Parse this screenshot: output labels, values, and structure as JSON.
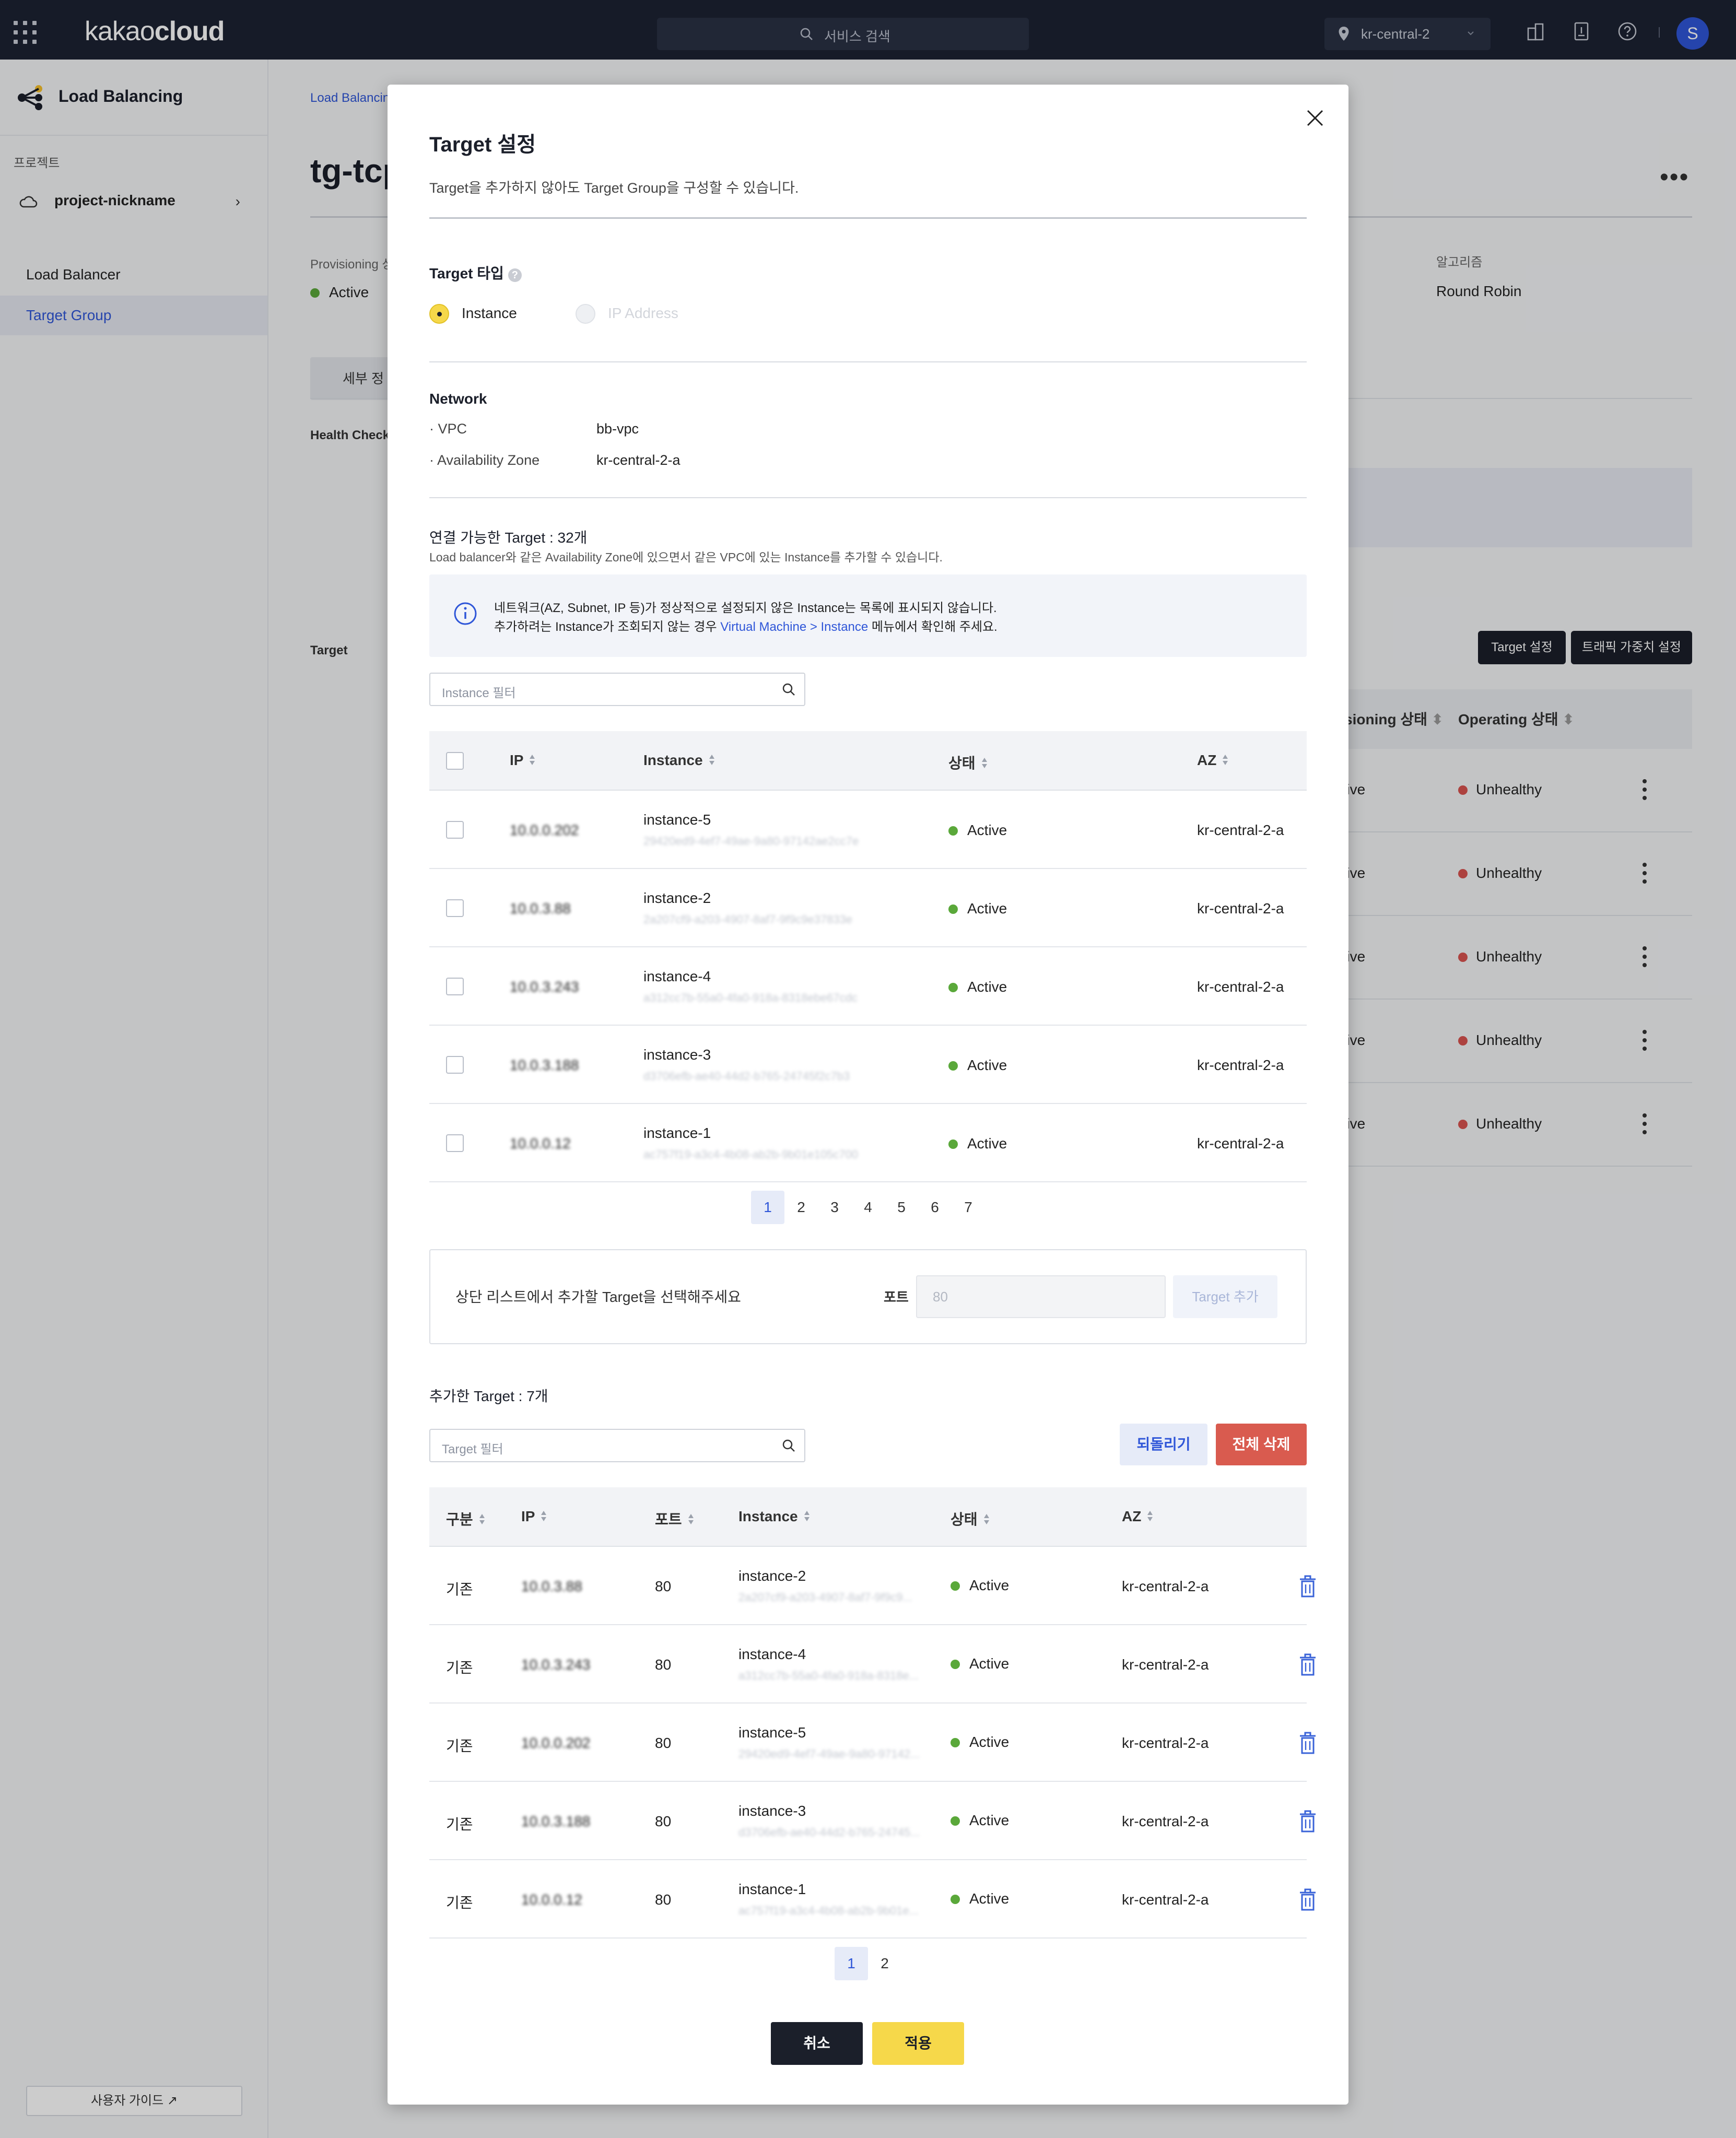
{
  "topbar": {
    "logo_light": "kakao",
    "logo_bold": "cloud",
    "search_placeholder": "서비스 검색",
    "region": "kr-central-2",
    "avatar": "S",
    "colors": {
      "bg": "#1c2233",
      "accent": "#2f56d8"
    }
  },
  "sidebar": {
    "title": "Load Balancing",
    "project_label": "프로젝트",
    "project_name": "project-nickname",
    "items": [
      {
        "label": "Load Balancer",
        "active": false
      },
      {
        "label": "Target Group",
        "active": true
      }
    ],
    "guide_label": "사용자 가이드"
  },
  "background": {
    "breadcrumb": "Load Balancin",
    "title": "tg-tcp",
    "provisioning_label": "Provisioning 상",
    "provisioning_value": "Active",
    "algorithm_label": "알고리즘",
    "algorithm_value": "Round Robin",
    "tab_label": "세부 정",
    "health_check_label": "Health Check",
    "target_label": "Target",
    "buttons": {
      "target_setting": "Target 설정",
      "weight_setting": "트래픽 가중치 설정"
    },
    "table_headers": {
      "provisioning": "Provisioning 상태",
      "operating": "Operating 상태"
    },
    "rows": [
      {
        "provisioning": "Active",
        "operating": "Unhealthy"
      },
      {
        "provisioning": "Active",
        "operating": "Unhealthy"
      },
      {
        "provisioning": "Active",
        "operating": "Unhealthy"
      },
      {
        "provisioning": "Active",
        "operating": "Unhealthy"
      },
      {
        "provisioning": "Active",
        "operating": "Unhealthy"
      }
    ]
  },
  "modal": {
    "title": "Target 설정",
    "description": "Target을 추가하지 않아도 Target Group을 구성할 수 있습니다.",
    "target_type": {
      "label": "Target 타입",
      "options": [
        {
          "label": "Instance",
          "selected": true
        },
        {
          "label": "IP Address",
          "selected": false
        }
      ]
    },
    "network": {
      "label": "Network",
      "vpc_key": "· VPC",
      "vpc_value": "bb-vpc",
      "az_key": "· Availability Zone",
      "az_value": "kr-central-2-a"
    },
    "available": {
      "title": "연결 가능한 Target : 32개",
      "subtitle": "Load balancer와 같은 Availability Zone에 있으면서 같은 VPC에 있는 Instance를 추가할 수 있습니다.",
      "info_line1": "네트워크(AZ, Subnet, IP 등)가 정상적으로 설정되지 않은 Instance는 목록에 표시되지 않습니다.",
      "info_line2_pre": "추가하려는 Instance가 조회되지 않는 경우 ",
      "info_link": "Virtual Machine > Instance",
      "info_line2_post": " 메뉴에서 확인해 주세요.",
      "filter_placeholder": "Instance 필터",
      "headers": {
        "ip": "IP",
        "instance": "Instance",
        "status": "상태",
        "az": "AZ"
      },
      "rows": [
        {
          "ip": "10.0.0.202",
          "name": "instance-5",
          "id": "29420ed9-4ef7-49ae-9a80-97142ae2cc7e",
          "status": "Active",
          "az": "kr-central-2-a"
        },
        {
          "ip": "10.0.3.88",
          "name": "instance-2",
          "id": "2a207cf9-a203-4907-8af7-9f9c9e37833e",
          "status": "Active",
          "az": "kr-central-2-a"
        },
        {
          "ip": "10.0.3.243",
          "name": "instance-4",
          "id": "a312cc7b-55a0-4fa0-918a-8318ebe67cdc",
          "status": "Active",
          "az": "kr-central-2-a"
        },
        {
          "ip": "10.0.3.188",
          "name": "instance-3",
          "id": "d3706efb-ae40-44d2-b765-24745f2c7b3",
          "status": "Active",
          "az": "kr-central-2-a"
        },
        {
          "ip": "10.0.0.12",
          "name": "instance-1",
          "id": "ac757f19-a3c4-4b08-ab2b-9b01e105c700",
          "status": "Active",
          "az": "kr-central-2-a"
        }
      ],
      "pages": [
        "1",
        "2",
        "3",
        "4",
        "5",
        "6",
        "7"
      ]
    },
    "add_box": {
      "message": "상단 리스트에서 추가할 Target을 선택해주세요",
      "port_label": "포트",
      "port_placeholder": "80",
      "add_button": "Target 추가"
    },
    "added": {
      "title": "추가한 Target : 7개",
      "filter_placeholder": "Target 필터",
      "revert_button": "되돌리기",
      "delete_all_button": "전체 삭제",
      "headers": {
        "type": "구분",
        "ip": "IP",
        "port": "포트",
        "instance": "Instance",
        "status": "상태",
        "az": "AZ"
      },
      "rows": [
        {
          "type": "기존",
          "ip": "10.0.3.88",
          "port": "80",
          "name": "instance-2",
          "id": "2a207cf9-a203-4907-8af7-9f9c9...",
          "status": "Active",
          "az": "kr-central-2-a"
        },
        {
          "type": "기존",
          "ip": "10.0.3.243",
          "port": "80",
          "name": "instance-4",
          "id": "a312cc7b-55a0-4fa0-918a-8318e...",
          "status": "Active",
          "az": "kr-central-2-a"
        },
        {
          "type": "기존",
          "ip": "10.0.0.202",
          "port": "80",
          "name": "instance-5",
          "id": "29420ed9-4ef7-49ae-9a80-97142...",
          "status": "Active",
          "az": "kr-central-2-a"
        },
        {
          "type": "기존",
          "ip": "10.0.3.188",
          "port": "80",
          "name": "instance-3",
          "id": "d3706efb-ae40-44d2-b765-24745...",
          "status": "Active",
          "az": "kr-central-2-a"
        },
        {
          "type": "기존",
          "ip": "10.0.0.12",
          "port": "80",
          "name": "instance-1",
          "id": "ac757f19-a3c4-4b08-ab2b-9b01e...",
          "status": "Active",
          "az": "kr-central-2-a"
        }
      ],
      "pages": [
        "1",
        "2"
      ]
    },
    "cancel_button": "취소",
    "apply_button": "적용"
  }
}
